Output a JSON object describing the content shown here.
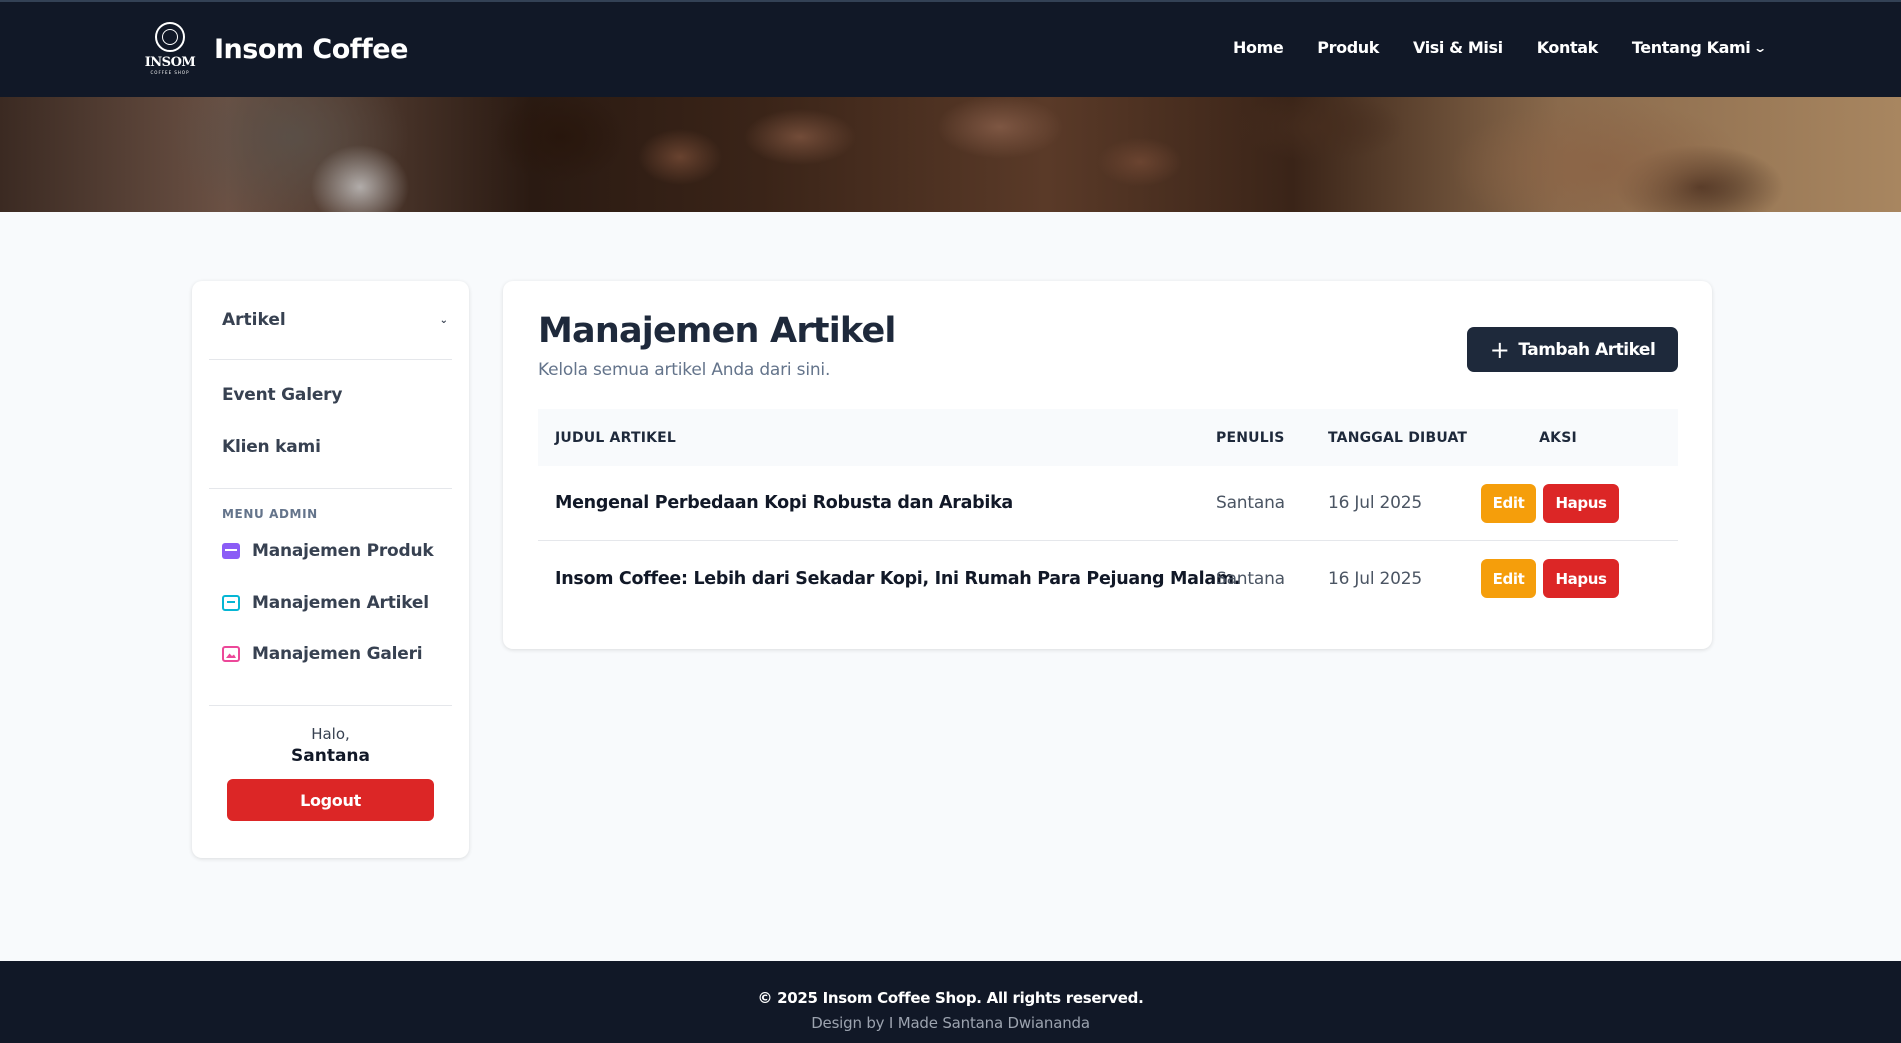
{
  "brand": {
    "logo_text": "INSOM",
    "logo_sub": "COFFEE SHOP",
    "name": "Insom Coffee"
  },
  "nav": {
    "items": [
      {
        "label": "Home"
      },
      {
        "label": "Produk"
      },
      {
        "label": "Visi & Misi"
      },
      {
        "label": "Kontak"
      },
      {
        "label": "Tentang Kami"
      }
    ]
  },
  "sidebar": {
    "dropdown_label": "Artikel",
    "links": [
      {
        "label": "Event Galery"
      },
      {
        "label": "Klien kami"
      }
    ],
    "admin_section_label": "MENU ADMIN",
    "admin_items": [
      {
        "label": "Manajemen Produk",
        "icon": "box-icon",
        "color": "#8b5cf6"
      },
      {
        "label": "Manajemen Artikel",
        "icon": "newspaper-icon",
        "color": "#06b6d4"
      },
      {
        "label": "Manajemen Galeri",
        "icon": "images-icon",
        "color": "#ec4899"
      }
    ],
    "greeting": "Halo,",
    "user_name": "Santana",
    "logout_label": "Logout"
  },
  "main": {
    "title": "Manajemen Artikel",
    "subtitle": "Kelola semua artikel Anda dari sini.",
    "add_button_label": "Tambah Artikel",
    "table": {
      "headers": [
        "JUDUL ARTIKEL",
        "PENULIS",
        "TANGGAL DIBUAT",
        "AKSI"
      ],
      "rows": [
        {
          "title": "Mengenal Perbedaan Kopi Robusta dan Arabika",
          "author": "Santana",
          "date": "16 Jul 2025",
          "edit_label": "Edit",
          "delete_label": "Hapus"
        },
        {
          "title": "Insom Coffee: Lebih dari Sekadar Kopi, Ini Rumah Para Pejuang Malam.",
          "author": "Santana",
          "date": "16 Jul 2025",
          "edit_label": "Edit",
          "delete_label": "Hapus"
        }
      ]
    }
  },
  "footer": {
    "copyright": "© 2025 Insom Coffee Shop. All rights reserved.",
    "credit": "Design by I Made Santana Dwiananda"
  },
  "colors": {
    "navbar_bg": "#111827",
    "primary_dark": "#1e293b",
    "danger": "#dc2626",
    "warning": "#f59e0b",
    "page_bg": "#f8fafc"
  }
}
